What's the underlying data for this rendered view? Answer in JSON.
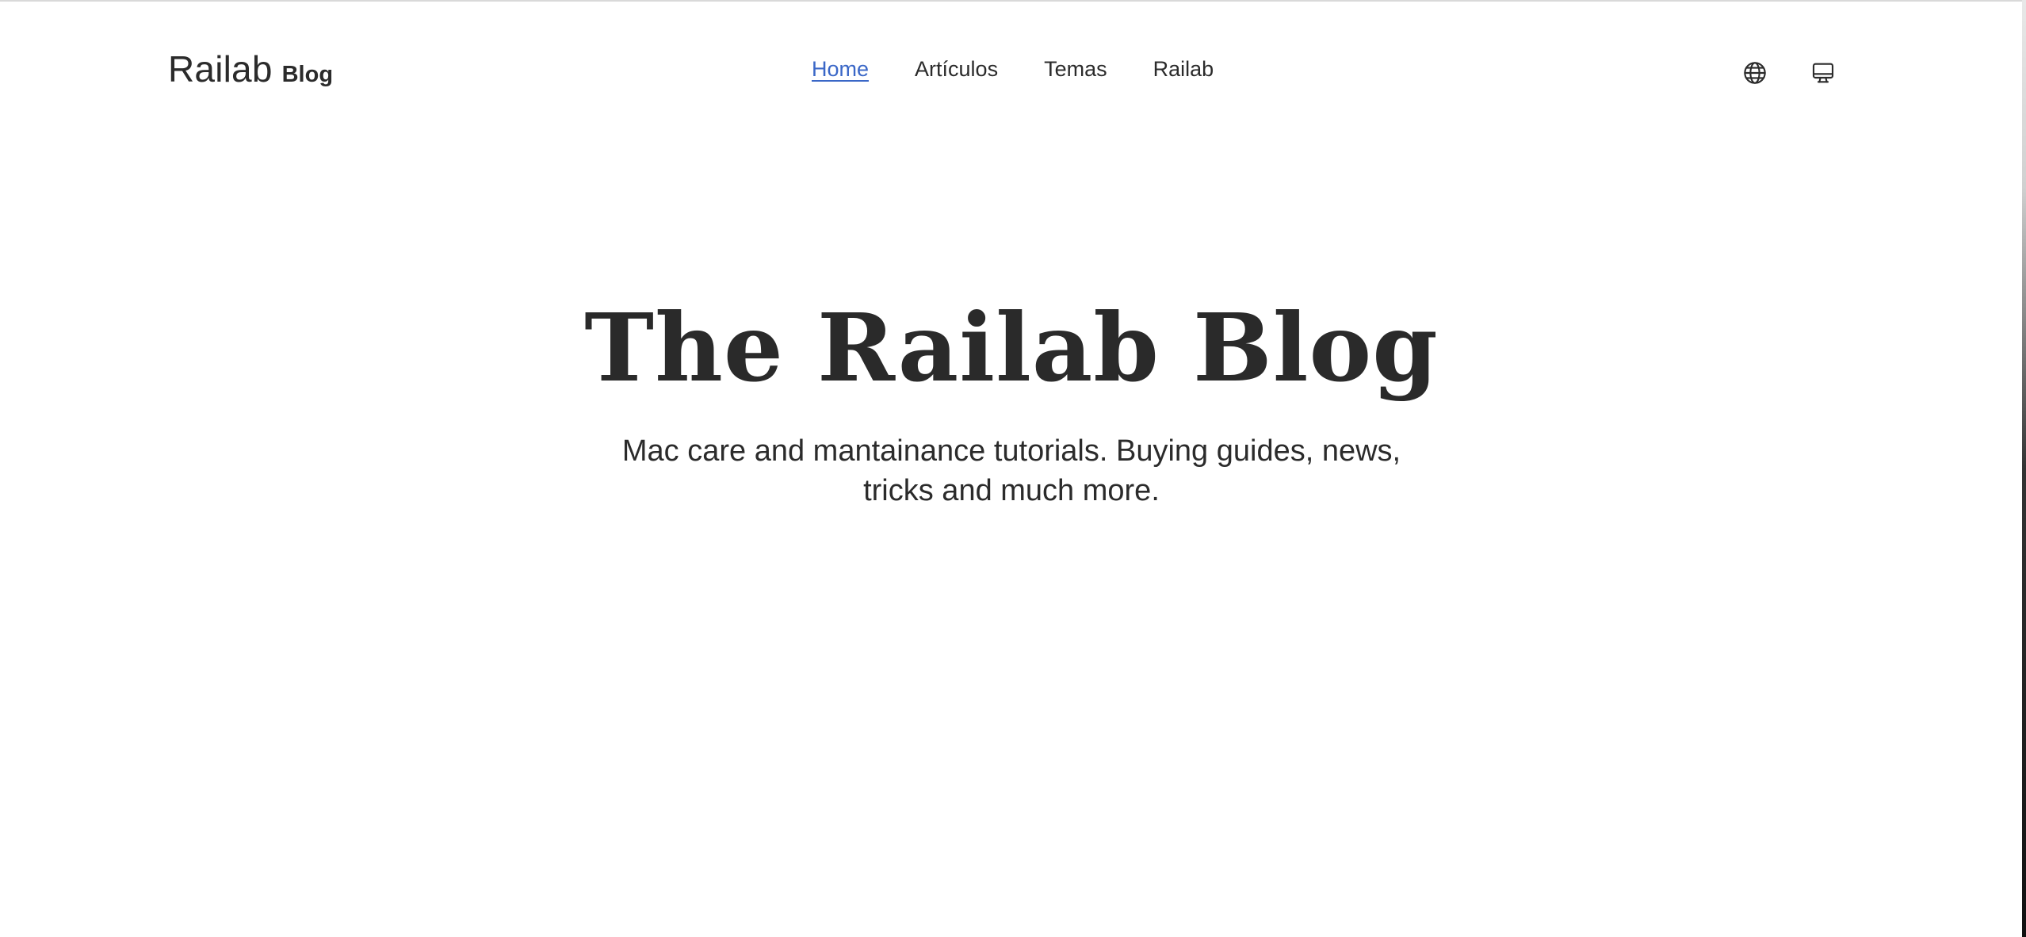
{
  "brand": {
    "name": "Railab",
    "sub": "Blog"
  },
  "nav": {
    "items": [
      {
        "label": "Home",
        "active": true
      },
      {
        "label": "Artículos",
        "active": false
      },
      {
        "label": "Temas",
        "active": false
      },
      {
        "label": "Railab",
        "active": false
      }
    ]
  },
  "header_icons": [
    {
      "name": "globe-icon"
    },
    {
      "name": "monitor-icon"
    }
  ],
  "hero": {
    "title": "The Railab Blog",
    "subtitle": "Mac care and mantainance tutorials. Buying guides, news, tricks and much more."
  },
  "colors": {
    "text": "#2b2b2b",
    "link_active": "#3a67c7",
    "background": "#ffffff"
  }
}
